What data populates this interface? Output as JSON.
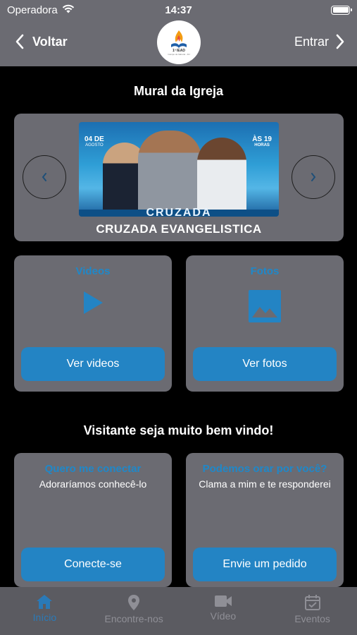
{
  "status_bar": {
    "carrier": "Operadora",
    "time": "14:37"
  },
  "nav": {
    "back_label": "Voltar",
    "login_label": "Entrar",
    "logo_text": "1ª IEAD",
    "logo_subtext": "Campo de Itaboraí - RJ"
  },
  "mural": {
    "title": "Mural da Igreja",
    "banner": {
      "date_left_day": "04 DE",
      "date_left_month": "AGOSTO",
      "time_right_prefix": "ÀS 19",
      "time_right_suffix": "HORAS",
      "strip_text": "CRUZADA"
    },
    "caption": "CRUZADA EVANGELISTICA"
  },
  "media": {
    "videos": {
      "title": "Videos",
      "button": "Ver videos"
    },
    "fotos": {
      "title": "Fotos",
      "button": "Ver fotos"
    }
  },
  "welcome": {
    "title": "Visitante seja muito bem vindo!",
    "conectar": {
      "title": "Quero me conectar",
      "text": "Adoraríamos conhecê-lo",
      "button": "Conecte-se"
    },
    "oracao": {
      "title": "Podemos orar por você?",
      "text": "Clama a mim e te responderei",
      "button": "Envie um pedido"
    }
  },
  "tabs": [
    {
      "label": "Início",
      "icon": "home-icon",
      "active": true
    },
    {
      "label": "Encontre-nos",
      "icon": "location-pin-icon",
      "active": false
    },
    {
      "label": "Vídeo",
      "icon": "video-camera-icon",
      "active": false
    },
    {
      "label": "Eventos",
      "icon": "calendar-check-icon",
      "active": false
    }
  ],
  "colors": {
    "surface": "#6b6b72",
    "accent": "#2384c4",
    "accent_text": "#1f88c9",
    "background": "#000000",
    "tab_inactive": "#8f8f96"
  }
}
